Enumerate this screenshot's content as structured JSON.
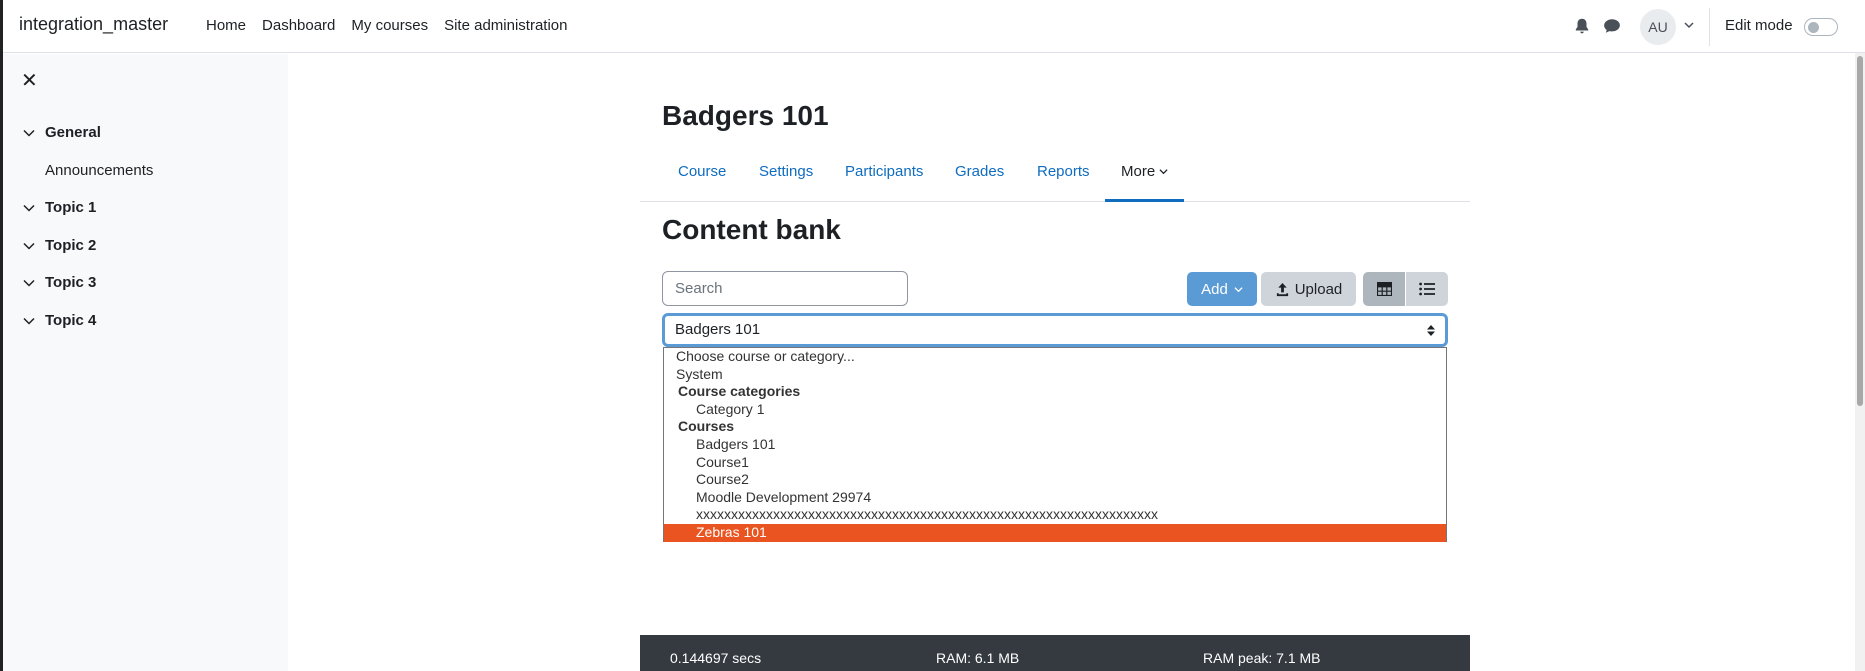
{
  "navbar": {
    "brand": "integration_master",
    "links": [
      "Home",
      "Dashboard",
      "My courses",
      "Site administration"
    ],
    "avatar_initials": "AU",
    "edit_mode_label": "Edit mode"
  },
  "drawer": {
    "close_icon": "close-icon",
    "sections": [
      {
        "label": "General",
        "items": [
          "Announcements"
        ]
      },
      {
        "label": "Topic 1"
      },
      {
        "label": "Topic 2"
      },
      {
        "label": "Topic 3"
      },
      {
        "label": "Topic 4"
      }
    ]
  },
  "course": {
    "title": "Badgers 101",
    "tabs": [
      "Course",
      "Settings",
      "Participants",
      "Grades",
      "Reports",
      "More"
    ],
    "active_tab": "More"
  },
  "content_bank": {
    "heading": "Content bank",
    "search_placeholder": "Search",
    "add_label": "Add",
    "upload_label": "Upload",
    "select_value": "Badgers 101",
    "options": [
      {
        "label": "Choose course or category...",
        "kind": "option"
      },
      {
        "label": "System",
        "kind": "option"
      },
      {
        "label": "Course categories",
        "kind": "group"
      },
      {
        "label": "Category 1",
        "kind": "child"
      },
      {
        "label": "Courses",
        "kind": "group"
      },
      {
        "label": "Badgers 101",
        "kind": "child"
      },
      {
        "label": "Course1",
        "kind": "child"
      },
      {
        "label": "Course2",
        "kind": "child"
      },
      {
        "label": "Moodle Development 29974",
        "kind": "child"
      },
      {
        "label": "xxxxxxxxxxxxxxxxxxxxxxxxxxxxxxxxxxxxxxxxxxxxxxxxxxxxxxxxxxxxxxxxxx",
        "kind": "child"
      },
      {
        "label": "Zebras 101",
        "kind": "child",
        "highlighted": true
      }
    ]
  },
  "footer": {
    "time": "0.144697 secs",
    "ram": "RAM: 6.1 MB",
    "ram_peak": "RAM peak: 7.1 MB"
  },
  "colors": {
    "accent": "#0f6cbf",
    "highlight": "#e95420",
    "footer_bg": "#343a40"
  }
}
